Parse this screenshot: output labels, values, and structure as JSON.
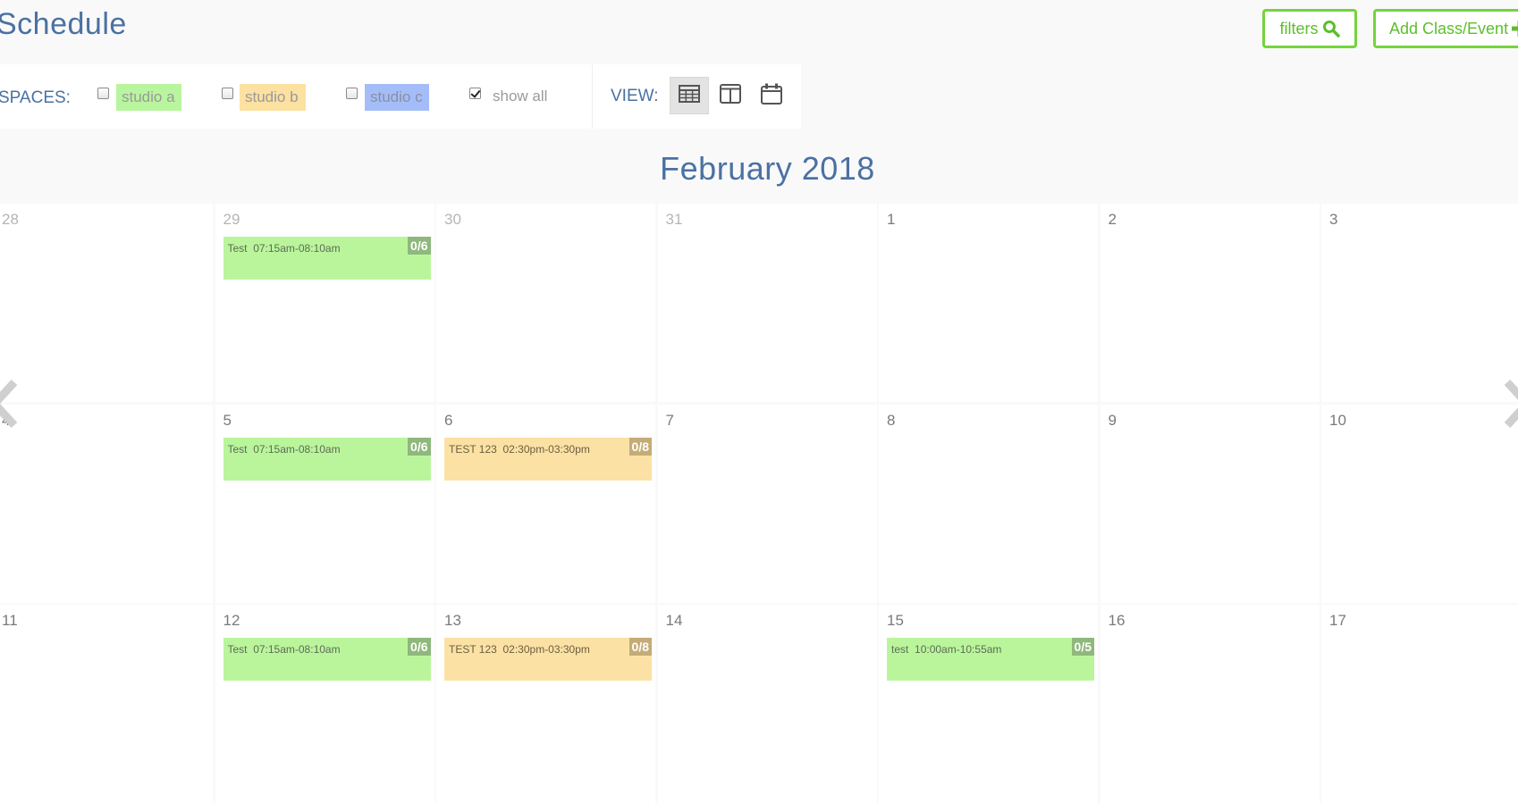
{
  "header": {
    "title": "Schedule",
    "filters_label": "filters",
    "add_label": "Add Class/Event"
  },
  "spaces": {
    "label": "SPACES:",
    "items": [
      {
        "label": "studio a",
        "checked": false,
        "color": "#b9f59e"
      },
      {
        "label": "studio b",
        "checked": false,
        "color": "#fde1a1"
      },
      {
        "label": "studio c",
        "checked": false,
        "color": "#a4bdf8"
      }
    ],
    "show_all_label": "show all",
    "show_all_checked": true
  },
  "view": {
    "label": "VIEW:",
    "options": [
      "month-grid-icon",
      "week-columns-icon",
      "day-calendar-icon"
    ],
    "active": "month"
  },
  "calendar": {
    "month_title": "February 2018",
    "weeks": [
      [
        {
          "day": "28",
          "other": true,
          "events": []
        },
        {
          "day": "29",
          "other": true,
          "events": [
            {
              "name": "Test",
              "time": "07:15am-08:10am",
              "count": "0/6",
              "color": "green"
            }
          ]
        },
        {
          "day": "30",
          "other": true,
          "events": []
        },
        {
          "day": "31",
          "other": true,
          "events": []
        },
        {
          "day": "1",
          "other": false,
          "events": []
        },
        {
          "day": "2",
          "other": false,
          "events": []
        },
        {
          "day": "3",
          "other": false,
          "events": []
        }
      ],
      [
        {
          "day": "4",
          "other": false,
          "events": []
        },
        {
          "day": "5",
          "other": false,
          "events": [
            {
              "name": "Test",
              "time": "07:15am-08:10am",
              "count": "0/6",
              "color": "green"
            }
          ]
        },
        {
          "day": "6",
          "other": false,
          "events": [
            {
              "name": "TEST 123",
              "time": "02:30pm-03:30pm",
              "count": "0/8",
              "color": "orange"
            }
          ]
        },
        {
          "day": "7",
          "other": false,
          "events": []
        },
        {
          "day": "8",
          "other": false,
          "events": []
        },
        {
          "day": "9",
          "other": false,
          "events": []
        },
        {
          "day": "10",
          "other": false,
          "events": []
        }
      ],
      [
        {
          "day": "11",
          "other": false,
          "events": []
        },
        {
          "day": "12",
          "other": false,
          "events": [
            {
              "name": "Test",
              "time": "07:15am-08:10am",
              "count": "0/6",
              "color": "green"
            }
          ]
        },
        {
          "day": "13",
          "other": false,
          "events": [
            {
              "name": "TEST 123",
              "time": "02:30pm-03:30pm",
              "count": "0/8",
              "color": "orange"
            }
          ]
        },
        {
          "day": "14",
          "other": false,
          "events": []
        },
        {
          "day": "15",
          "other": false,
          "events": [
            {
              "name": "test",
              "time": "10:00am-10:55am",
              "count": "0/5",
              "color": "green"
            }
          ]
        },
        {
          "day": "16",
          "other": false,
          "events": []
        },
        {
          "day": "17",
          "other": false,
          "events": []
        }
      ]
    ]
  },
  "colors": {
    "accent_green": "#74d43c",
    "title_blue": "#4a71a3",
    "event_green": "#baf59c",
    "event_orange": "#fce1a4"
  }
}
